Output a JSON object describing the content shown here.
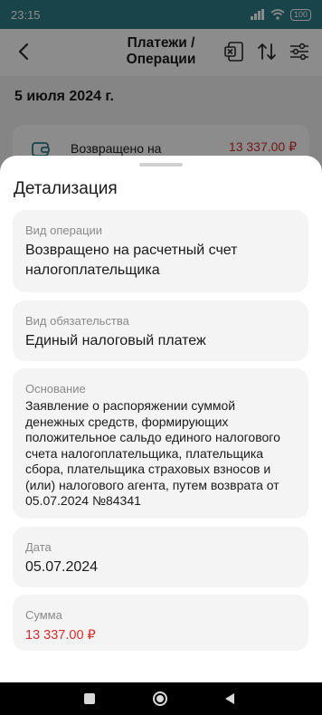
{
  "status_bar": {
    "time": "23:15",
    "battery": "100"
  },
  "header": {
    "title_line1": "Платежи /",
    "title_line2": "Операции"
  },
  "list": {
    "date": "5 июля 2024 г.",
    "operation": {
      "title": "Возвращено на",
      "amount": "13 337.00 ₽"
    }
  },
  "sheet": {
    "title": "Детализация",
    "fields": [
      {
        "label": "Вид операции",
        "value_line1": "Возвращено на расчетный счет",
        "value_line2": "налогоплательщика"
      },
      {
        "label": "Вид обязательства",
        "value": "Единый налоговый платеж"
      },
      {
        "label": "Основание",
        "value_lines": [
          "Заявление  о распоряжении суммой",
          "денежных средств, формирующих",
          "положительное сальдо единого налогового",
          "счета налогоплательщика, плательщика",
          "сбора, плательщика страховых взносов и",
          "(или) налогового агента, путем возврата от",
          "05.07.2024 №84341"
        ]
      },
      {
        "label": "Дата",
        "value": "05.07.2024"
      },
      {
        "label": "Сумма",
        "value": "13 337.00 ₽"
      }
    ]
  },
  "colors": {
    "accent": "#2d7d88",
    "amount": "#d32f2f"
  }
}
